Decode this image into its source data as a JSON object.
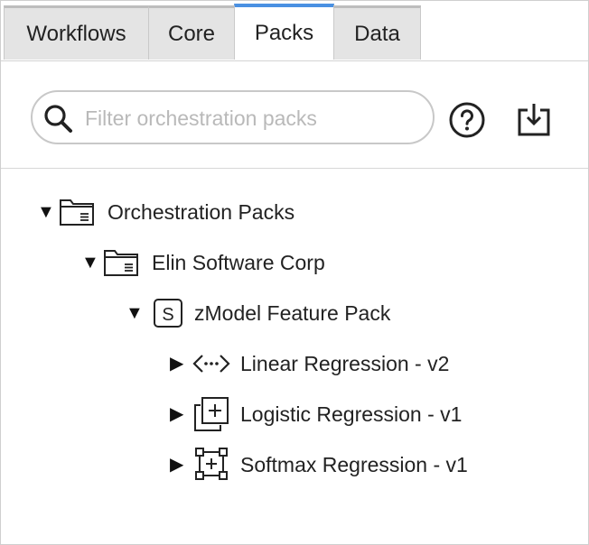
{
  "tabs": [
    {
      "label": "Workflows",
      "active": false
    },
    {
      "label": "Core",
      "active": false
    },
    {
      "label": "Packs",
      "active": true
    },
    {
      "label": "Data",
      "active": false
    }
  ],
  "accent_color": "#4a90e2",
  "toolbar": {
    "search_placeholder": "Filter orchestration packs",
    "search_value": "",
    "help_icon": "question-circle-icon",
    "import_icon": "download-tray-icon"
  },
  "tree": {
    "root": {
      "label": "Orchestration Packs",
      "expanded": true,
      "icon": "folder-icon"
    },
    "vendor": {
      "label": "Elin Software Corp",
      "expanded": true,
      "icon": "folder-icon"
    },
    "pack": {
      "label": "zModel Feature Pack",
      "expanded": true,
      "icon": "s-box-icon"
    },
    "items": [
      {
        "label": "Linear Regression - v2",
        "expanded": false,
        "icon": "dotted-arrows-icon"
      },
      {
        "label": "Logistic Regression - v1",
        "expanded": false,
        "icon": "stacked-plus-icon"
      },
      {
        "label": "Softmax Regression - v1",
        "expanded": false,
        "icon": "selection-plus-icon"
      }
    ]
  }
}
